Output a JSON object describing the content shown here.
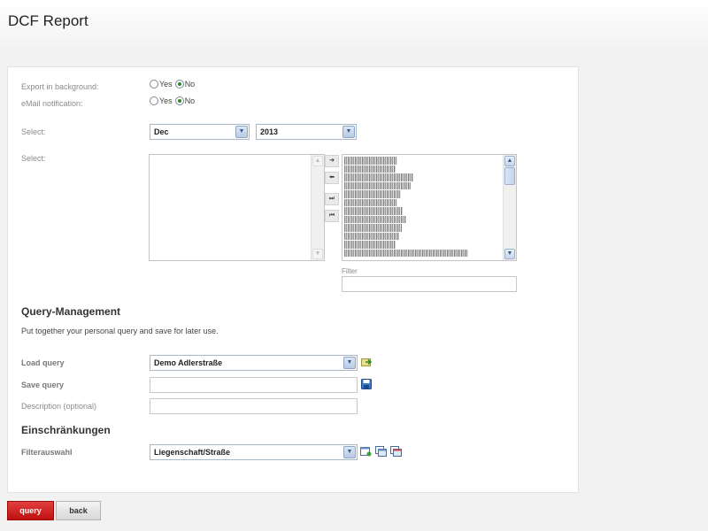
{
  "page": {
    "title": "DCF Report"
  },
  "form": {
    "export_background": {
      "label": "Export in background:",
      "yes": "Yes",
      "no": "No",
      "selected": "No"
    },
    "email_notification": {
      "label": "eMail notification:",
      "yes": "Yes",
      "no": "No",
      "selected": "No"
    },
    "select_period": {
      "label": "Select:",
      "month": "Dec",
      "year": "2013"
    },
    "select_items": {
      "label": "Select:",
      "filter_label": "Filter",
      "filter_value": ""
    }
  },
  "query_management": {
    "title": "Query-Management",
    "description": "Put together your personal query and save for later use.",
    "load_query": {
      "label": "Load query",
      "value": "Demo Adlerstraße"
    },
    "save_query": {
      "label": "Save query",
      "value": ""
    },
    "description_field": {
      "label": "Description (optional)",
      "value": ""
    }
  },
  "restrictions": {
    "title": "Einschränkungen",
    "filter_selection": {
      "label": "Filterauswahl",
      "value": "Liegenschaft/Straße"
    }
  },
  "actions": {
    "query_label": "query",
    "back_label": "back"
  },
  "icons": {
    "move_right": "arrow-right-icon",
    "move_left": "arrow-left-icon",
    "move_all_right": "double-arrow-right-icon",
    "move_all_left": "double-arrow-left-icon",
    "load": "load-query-icon",
    "save": "save-disk-icon",
    "filter_new": "add-filter-icon",
    "filter_edit": "edit-filter-icon",
    "filter_delete": "delete-filter-icon"
  },
  "colors": {
    "primary_button": "#c81818",
    "radio_selected": "#2a8a2a"
  }
}
